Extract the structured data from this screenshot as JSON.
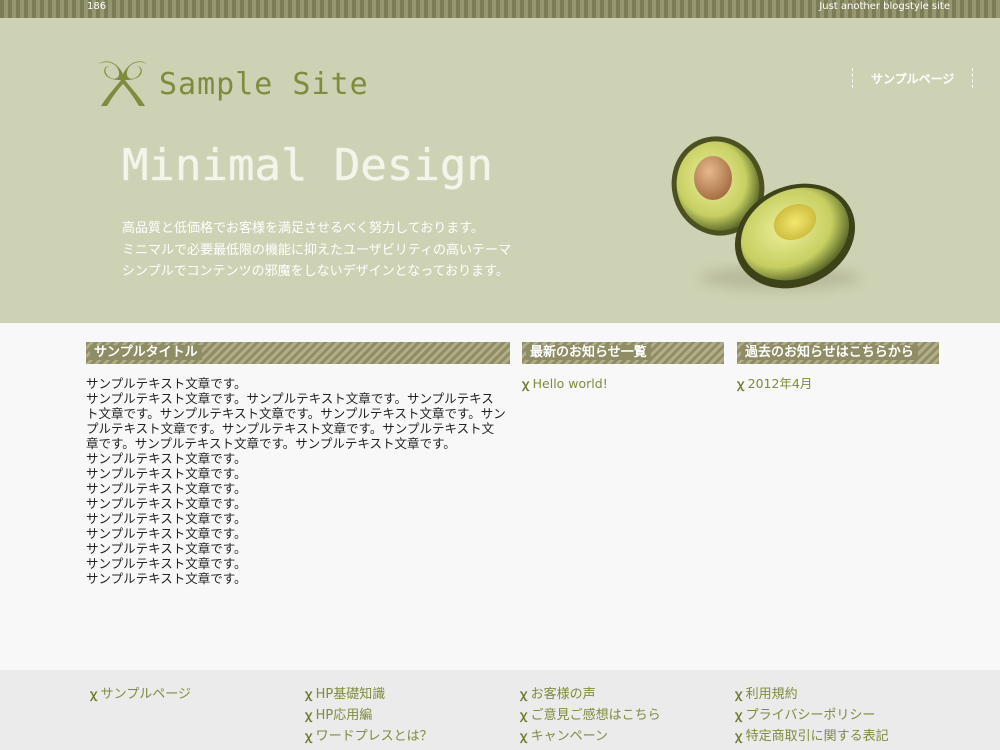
{
  "topbar": {
    "number": "186",
    "tagline": "Just another blogstyle site"
  },
  "header": {
    "logo_text": "Sample Site",
    "nav": [
      {
        "label": "サンプルページ"
      }
    ],
    "hero_title": "Minimal Design",
    "hero_lines": [
      "高品質と低価格でお客様を満足させるべく努力しております。",
      "ミニマルで必要最低限の機能に抑えたユーザビリティの高いテーマ",
      "シンプルでコンテンツの邪魔をしないデザインとなっております。"
    ]
  },
  "main": {
    "title": "サンプルタイトル",
    "paragraph_first": "サンプルテキスト文章です。",
    "paragraph_long": "サンプルテキスト文章です。サンプルテキスト文章です。サンプルテキスト文章です。サンプルテキスト文章です。サンプルテキスト文章です。サンプルテキスト文章です。サンプルテキスト文章です。サンプルテキスト文章です。サンプルテキスト文章です。サンプルテキスト文章です。",
    "lines": [
      "サンプルテキスト文章です。",
      "サンプルテキスト文章です。",
      "サンプルテキスト文章です。",
      "サンプルテキスト文章です。",
      "サンプルテキスト文章です。",
      "サンプルテキスト文章です。",
      "サンプルテキスト文章です。",
      "サンプルテキスト文章です。",
      "サンプルテキスト文章です。"
    ]
  },
  "news": {
    "title": "最新のお知らせ一覧",
    "items": [
      "Hello world!"
    ]
  },
  "archive": {
    "title": "過去のお知らせはこちらから",
    "items": [
      "2012年4月"
    ]
  },
  "footer": {
    "col1": [
      "サンプルページ"
    ],
    "col2": [
      "HP基礎知識",
      "HP応用編",
      "ワードプレスとは？"
    ],
    "col3": [
      "お客様の声",
      "ご意見ご感想はこちら",
      "キャンペーン"
    ],
    "col4": [
      "利用規約",
      "プライバシーポリシー",
      "特定商取引に関する表記"
    ]
  },
  "colors": {
    "accent": "#7f8b3d",
    "header_bg": "#cdd2b4",
    "footer_bg": "#ebebeb"
  },
  "icons": {
    "list_marker": "leaf-icon",
    "logo": "ribbon-logo-icon"
  }
}
